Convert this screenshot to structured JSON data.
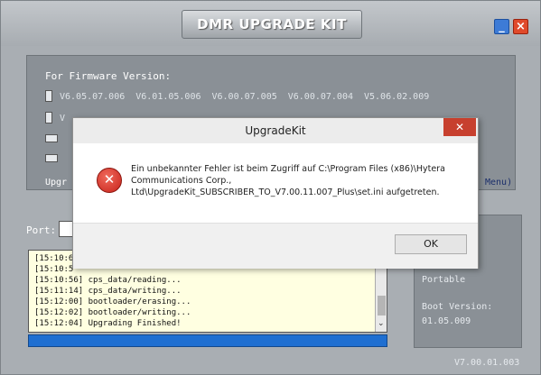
{
  "app": {
    "title": "DMR UPGRADE KIT",
    "minimize_glyph": "_",
    "close_glyph": "×"
  },
  "firmware": {
    "label": "For Firmware Version:",
    "row1": [
      "V6.05.07.006",
      "V6.01.05.006",
      "V6.00.07.005",
      "V6.00.07.004",
      "V5.06.02.009"
    ],
    "row2": [
      "V",
      "",
      "",
      ""
    ],
    "upgr_label": "Upgr",
    "menu_label": "Menu)"
  },
  "port": {
    "label": "Port:"
  },
  "log": {
    "lines": [
      "[15:10:6",
      "[15:10:5",
      "[15:10:56] cps_data/reading...",
      "[15:11:14] cps_data/writing...",
      "[15:12:00] bootloader/erasing...",
      "[15:12:02] bootloader/writing...",
      "[15:12:04] Upgrading Finished!"
    ],
    "scroll_arrow": "⌄"
  },
  "side_panel": {
    "portable": "Portable",
    "boot_label": "Boot Version:",
    "boot_value": "01.05.009"
  },
  "footer": {
    "version": "V7.00.01.003"
  },
  "dialog": {
    "title": "UpgradeKit",
    "close_glyph": "✕",
    "error_glyph": "✕",
    "message": "Ein unbekannter Fehler ist beim Zugriff auf C:\\Program Files (x86)\\Hytera Communications Corp., Ltd\\UpgradeKit_SUBSCRIBER_TO_V7.00.11.007_Plus\\set.ini aufgetreten.",
    "ok_label": "OK"
  },
  "colors": {
    "progress": "#1f6fd1",
    "error_red": "#c7221a",
    "log_bg": "#ffffe1"
  }
}
